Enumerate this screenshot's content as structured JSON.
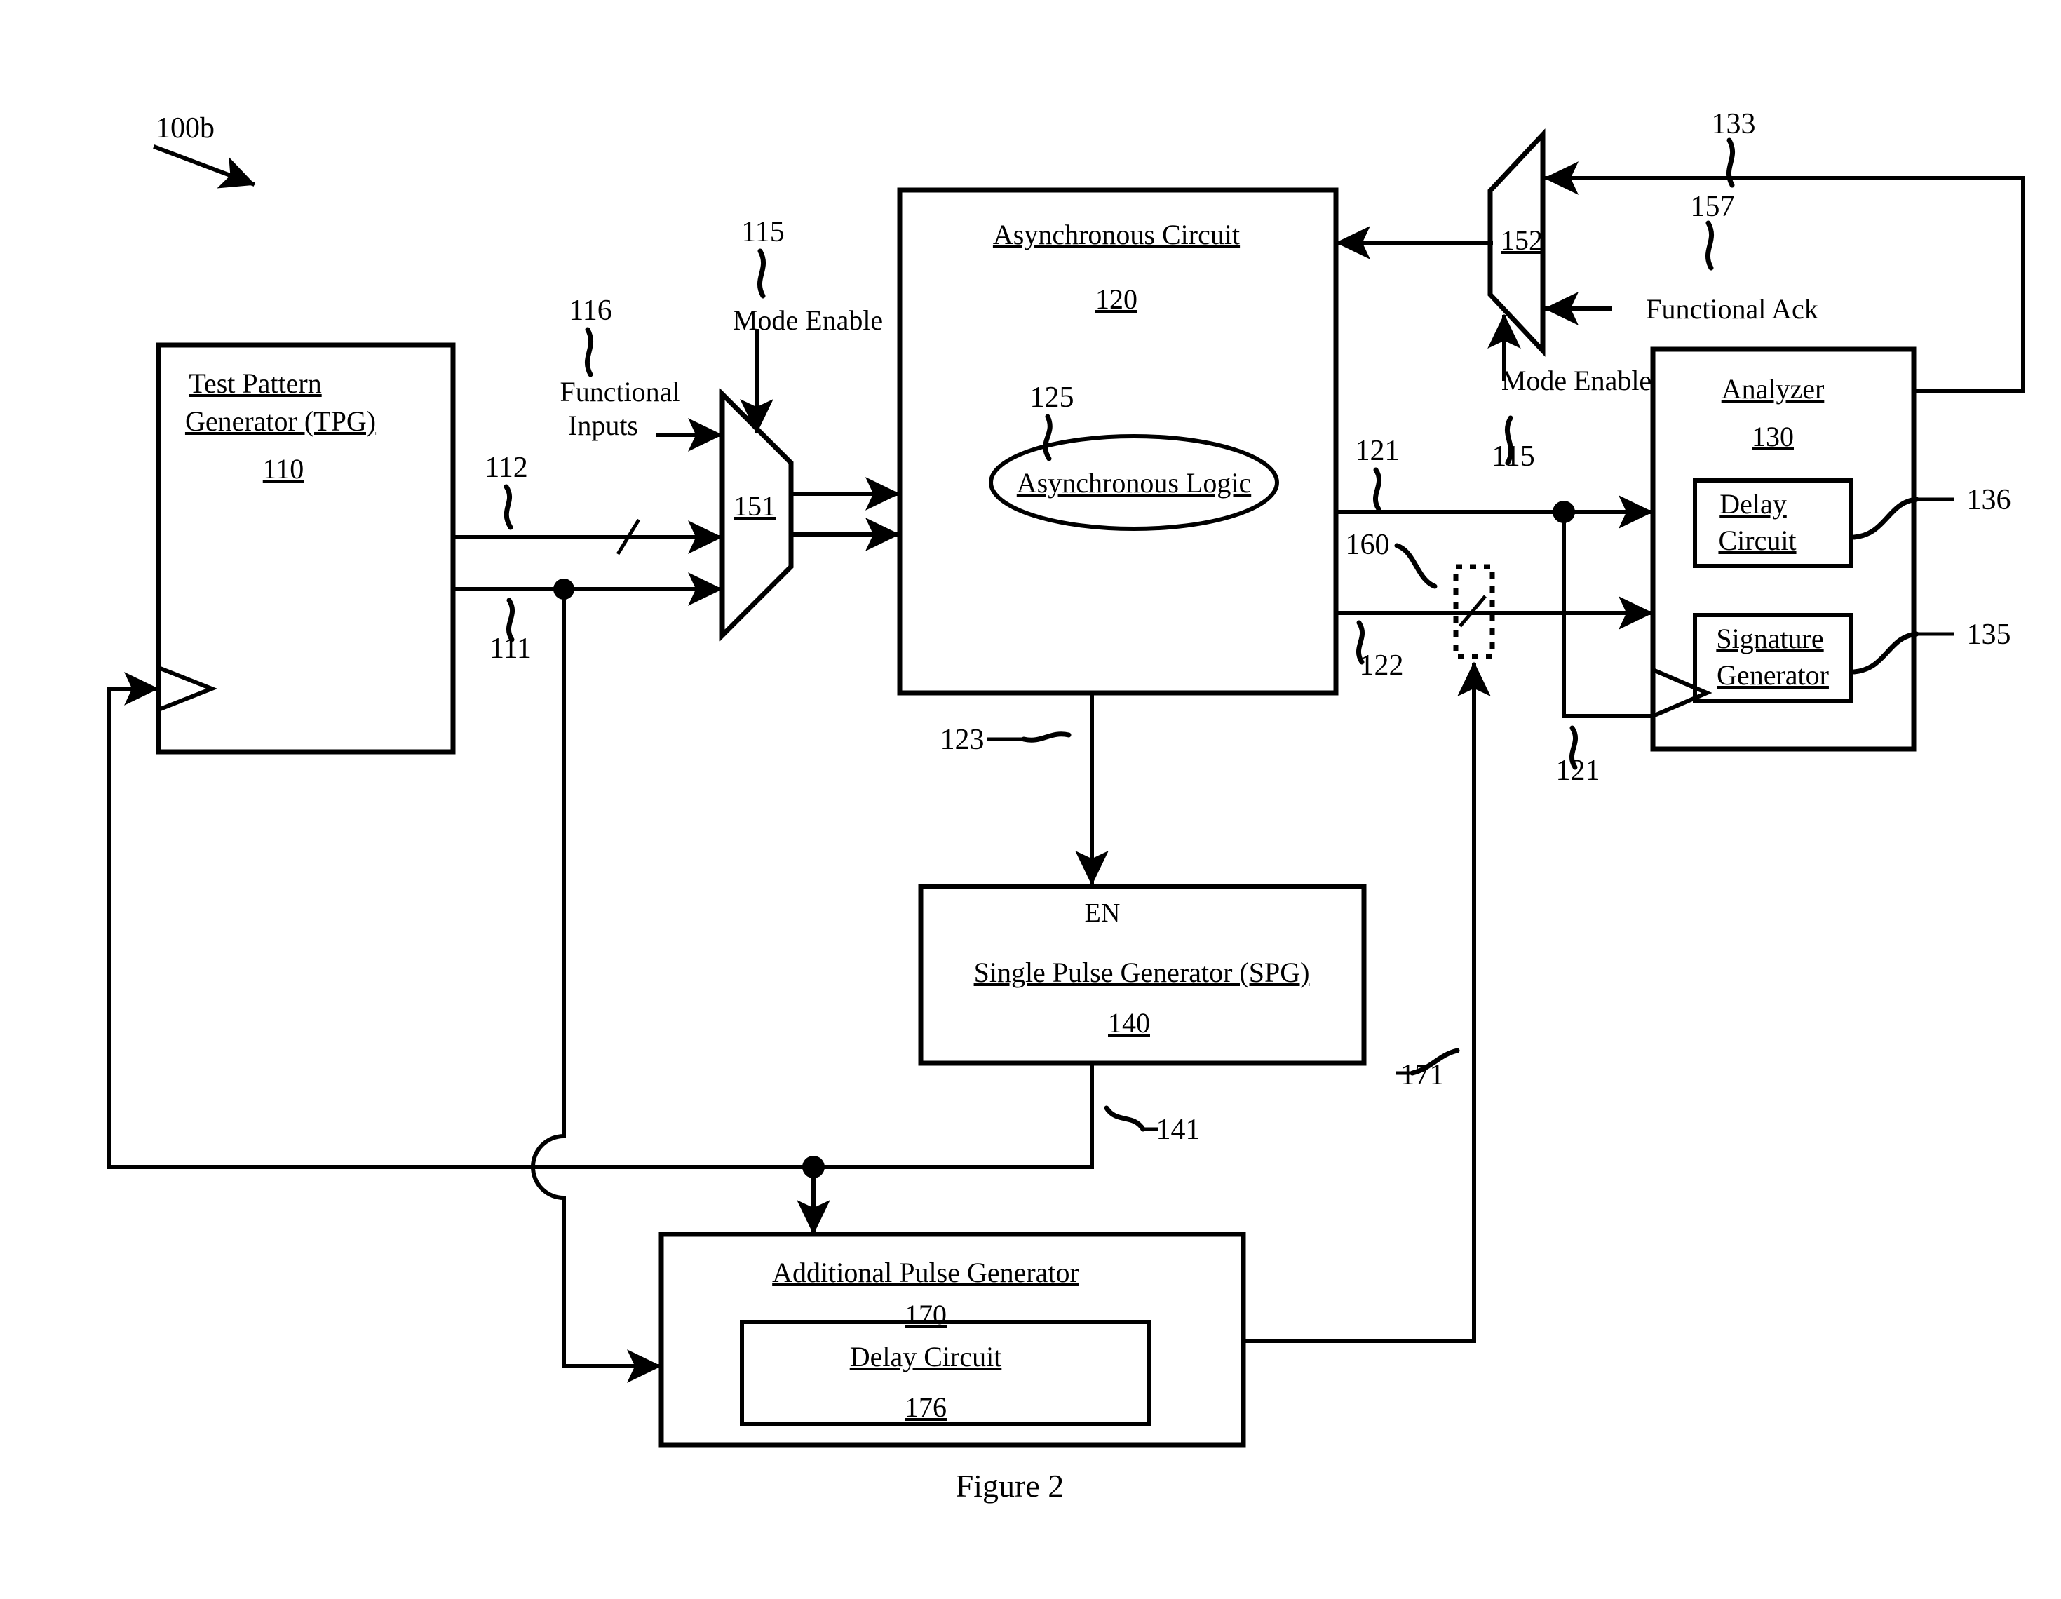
{
  "figure": {
    "caption": "Figure 2",
    "system_ref": "100b"
  },
  "blocks": {
    "tpg": {
      "title_line1": "Test Pattern",
      "title_line2": "Generator (TPG)",
      "ref": "110"
    },
    "async_circuit": {
      "title": "Asynchronous Circuit",
      "ref": "120",
      "logic_label": "Asynchronous Logic",
      "logic_ref": "125"
    },
    "analyzer": {
      "title": "Analyzer",
      "ref": "130",
      "delay_circuit_line1": "Delay",
      "delay_circuit_line2": "Circuit",
      "delay_circuit_ref": "136",
      "signature_line1": "Signature",
      "signature_line2": "Generator",
      "signature_ref": "135"
    },
    "spg": {
      "enable_label": "EN",
      "title": "Single Pulse Generator (SPG)",
      "ref": "140"
    },
    "apg": {
      "title": "Additional Pulse Generator",
      "ref": "170",
      "delay_circuit_title": "Delay Circuit",
      "delay_circuit_ref": "176"
    }
  },
  "muxes": {
    "input_mux": {
      "ref": "151"
    },
    "ack_mux": {
      "ref": "152"
    }
  },
  "signals": {
    "functional_inputs": "Functional Inputs",
    "functional_inputs_line1": "Functional",
    "functional_inputs_line2": "Inputs",
    "functional_inputs_ref": "116",
    "mode_enable_left": "Mode Enable",
    "mode_enable_left_ref": "115",
    "mode_enable_right": "Mode Enable",
    "mode_enable_right_ref": "115",
    "functional_ack": "Functional Ack",
    "functional_ack_ref": "157",
    "ack_feedback_ref": "133",
    "tpg_out_top_ref": "112",
    "tpg_out_bottom_ref": "111",
    "async_out_top_ref": "121",
    "async_out_bottom_ref": "122",
    "async_out_done_ref": "123",
    "analyzer_clk_ref": "121",
    "observe_point_ref": "160",
    "spg_out_ref": "141",
    "apg_out_ref": "171"
  },
  "colors": {
    "ink": "#000000",
    "paper": "#ffffff"
  }
}
